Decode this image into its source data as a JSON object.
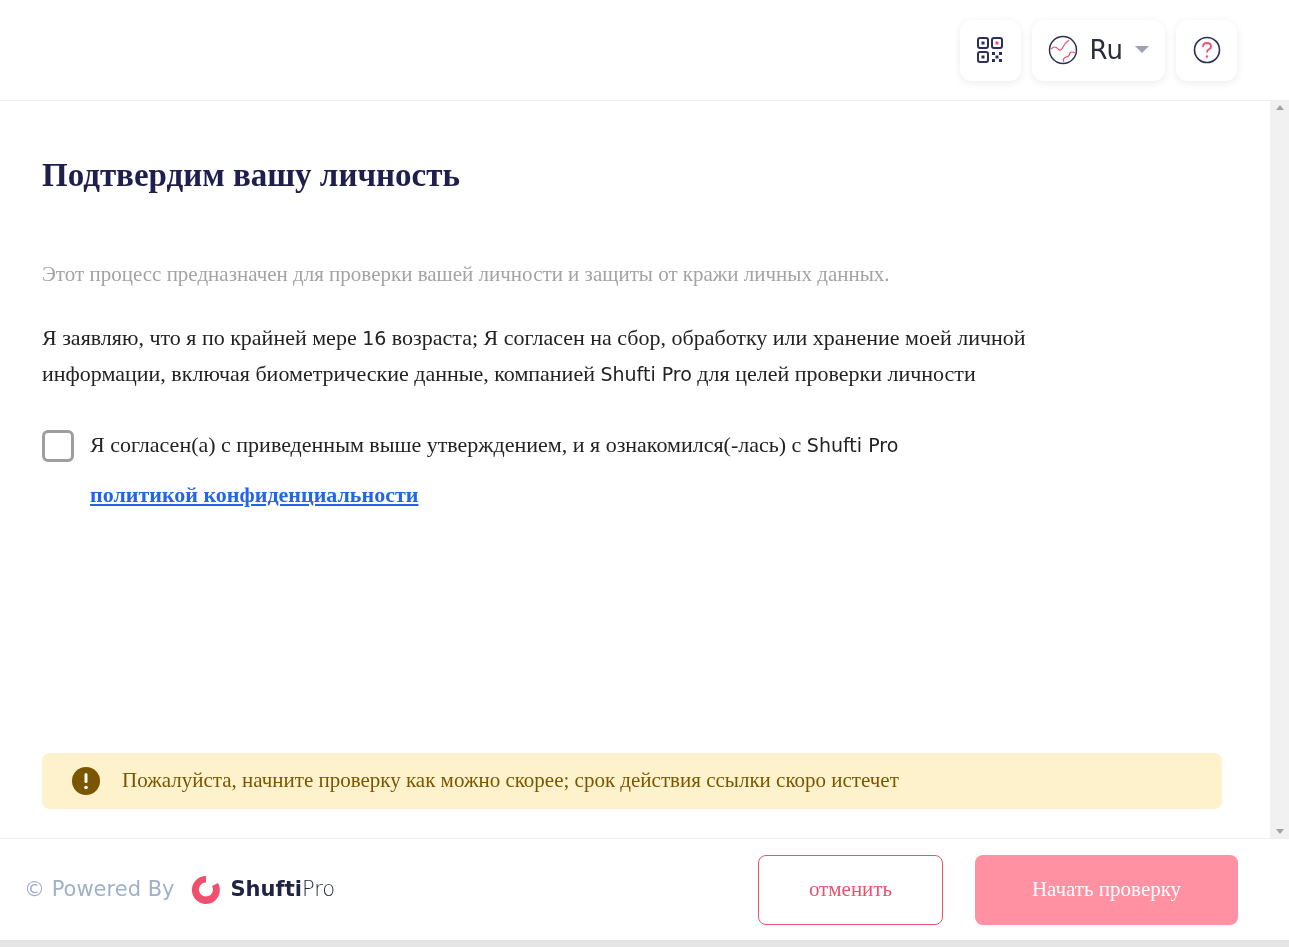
{
  "header": {
    "language": "Ru"
  },
  "title": "Подтвердим вашу личность",
  "intro": "Этот процесс предназначен для проверки вашей личности и защиты от кражи личных данных.",
  "declaration": [
    {
      "kind": "serif",
      "text": "Я заявляю, что я по крайней мере "
    },
    {
      "kind": "sans",
      "text": "16"
    },
    {
      "kind": "serif",
      "text": " возраста; Я согласен на сбор, обработку или хранение моей личной информации, включая биометрические данные, компанией "
    },
    {
      "kind": "sans",
      "text": "Shufti Pro"
    },
    {
      "kind": "serif",
      "text": " для целей проверки личности"
    }
  ],
  "consent": {
    "checked": false,
    "parts": [
      {
        "kind": "serif",
        "text": "Я согласен(а) с приведенным выше утверждением, и я ознакомился(-лась) с "
      },
      {
        "kind": "sans",
        "text": "Shufti Pro "
      },
      {
        "kind": "link",
        "text": "политикой конфиденциальности"
      }
    ]
  },
  "warning": "Пожалуйста, начните проверку как можно скорее; срок действия ссылки скоро истечет",
  "footer": {
    "powered_by": "© Powered By",
    "brand": {
      "name": "Shufti",
      "suffix": "Pro"
    },
    "cancel": "отменить",
    "start": {
      "label": "Начать проверку",
      "disabled": true
    }
  }
}
